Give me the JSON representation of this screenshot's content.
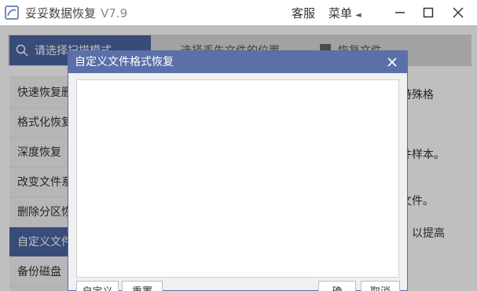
{
  "titlebar": {
    "app_name": "妥妥数据恢复",
    "version": "V7.9",
    "service_label": "客服",
    "menu_label": "菜单",
    "menu_arrow": "◄"
  },
  "steps": {
    "step1": "请选择扫描模式",
    "step2": "选择丢失文件的位置",
    "step3": "恢复文件"
  },
  "sidebar": {
    "items": [
      {
        "label": "快速恢复删"
      },
      {
        "label": "格式化恢复"
      },
      {
        "label": "深度恢复"
      },
      {
        "label": "改变文件系"
      },
      {
        "label": "删除分区恢"
      },
      {
        "label": "自定义文件"
      },
      {
        "label": "备份磁盘"
      }
    ]
  },
  "descriptions": {
    "line1": "特殊格",
    "line2": "件样本。",
    "line3": "。",
    "line4": "文件。",
    "line5": "，以提高"
  },
  "dialog": {
    "title": "自定义文件格式恢复",
    "text_value": "",
    "buttons": {
      "define": "自定义",
      "reset": "重置",
      "ok": "确",
      "cancel": "取消"
    }
  },
  "colors": {
    "accent": "#4a66a0",
    "dialog_title_bg": "#5b6fa8"
  }
}
